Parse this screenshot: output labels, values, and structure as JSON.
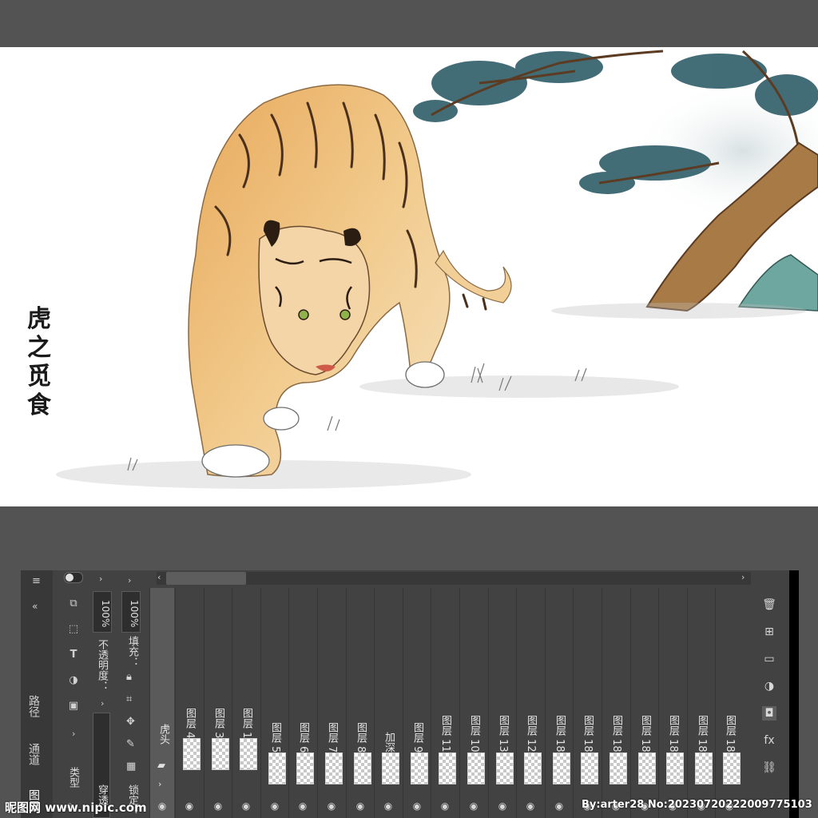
{
  "panel_tabs": {
    "layers": "图层",
    "channels": "通道",
    "paths": "路径"
  },
  "filter": {
    "kind_label": "类型"
  },
  "blend": {
    "mode": "穿透",
    "opacity_label": "不透明度：",
    "opacity_value": "100%"
  },
  "lock": {
    "lock_label": "锁定：",
    "fill_label": "填充：",
    "fill_value": "100%"
  },
  "group": {
    "name": "虎头"
  },
  "layers": [
    {
      "name": "图层 4"
    },
    {
      "name": "图层 3"
    },
    {
      "name": "图层 1"
    },
    {
      "name": "图层 5"
    },
    {
      "name": "图层 6"
    },
    {
      "name": "图层 7"
    },
    {
      "name": "图层 8"
    },
    {
      "name": "加深"
    },
    {
      "name": "图层 9"
    },
    {
      "name": "图层 11"
    },
    {
      "name": "图层 10"
    },
    {
      "name": "图层 13"
    },
    {
      "name": "图层 12"
    },
    {
      "name": "图层 18"
    },
    {
      "name": "图层 18"
    },
    {
      "name": "图层 18"
    },
    {
      "name": "图层 18"
    },
    {
      "name": "图层 18"
    },
    {
      "name": "图层 18"
    },
    {
      "name": "图层 18"
    }
  ],
  "artwork": {
    "calligraphy": "虎之觅食"
  },
  "watermark": {
    "left": "昵图网 www.nipic.com",
    "right": "By:arter28 No:20230720222009775103"
  },
  "colors": {
    "panel_bg": "#424242",
    "app_bg": "#535353",
    "canvas_bg": "#ffffff"
  }
}
